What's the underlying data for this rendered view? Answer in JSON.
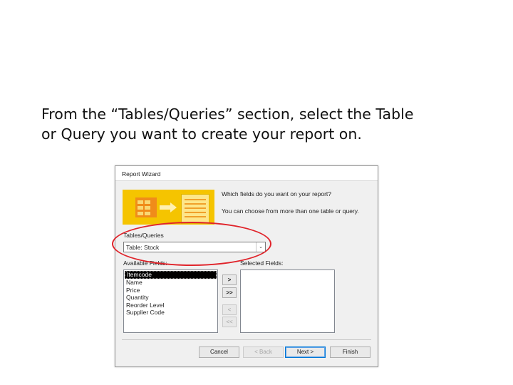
{
  "caption": {
    "line1": "From the “Tables/Queries” section, select the Table",
    "line2": "or Query you want to create your report on."
  },
  "dialog": {
    "title": "Report Wizard",
    "prompt_question": "Which fields do you want on your report?",
    "prompt_hint": "You can choose from more than one table or query.",
    "tables_queries_label": "Tables/Queries",
    "tables_queries_value": "Table: Stock",
    "available_fields_label": "Available Fields:",
    "selected_fields_label": "Selected Fields:",
    "available_fields": [
      "Itemcode",
      "Name",
      "Price",
      "Quantity",
      "Reorder Level",
      "Supplier Code"
    ],
    "selected_field_index": 0,
    "move_buttons": {
      "add_one": ">",
      "add_all": ">>",
      "remove_one": "<",
      "remove_all": "<<"
    },
    "buttons": {
      "cancel": "Cancel",
      "back": "< Back",
      "next": "Next >",
      "finish": "Finish"
    }
  },
  "annotation": {
    "highlight_color": "#e0232a"
  }
}
